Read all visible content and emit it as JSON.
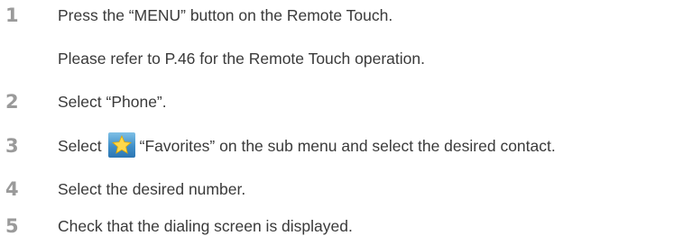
{
  "steps": [
    {
      "number": "1",
      "text": "Press the “MENU” button on the Remote Touch.",
      "subtext": "Please refer to P.46 for the Remote Touch operation."
    },
    {
      "number": "2",
      "text": "Select “Phone”."
    },
    {
      "number": "3",
      "text_before": "Select",
      "icon": "favorites-star-icon",
      "text_after": "“Favorites” on the sub menu and select the desired contact."
    },
    {
      "number": "4",
      "text": "Select the desired number."
    },
    {
      "number": "5",
      "text": "Check that the dialing screen is displayed."
    }
  ],
  "colors": {
    "step_number": "#9a9a9a",
    "text": "#3a3a3a",
    "icon_bg": "#3f8fc9",
    "icon_star": "#ffd84a"
  }
}
